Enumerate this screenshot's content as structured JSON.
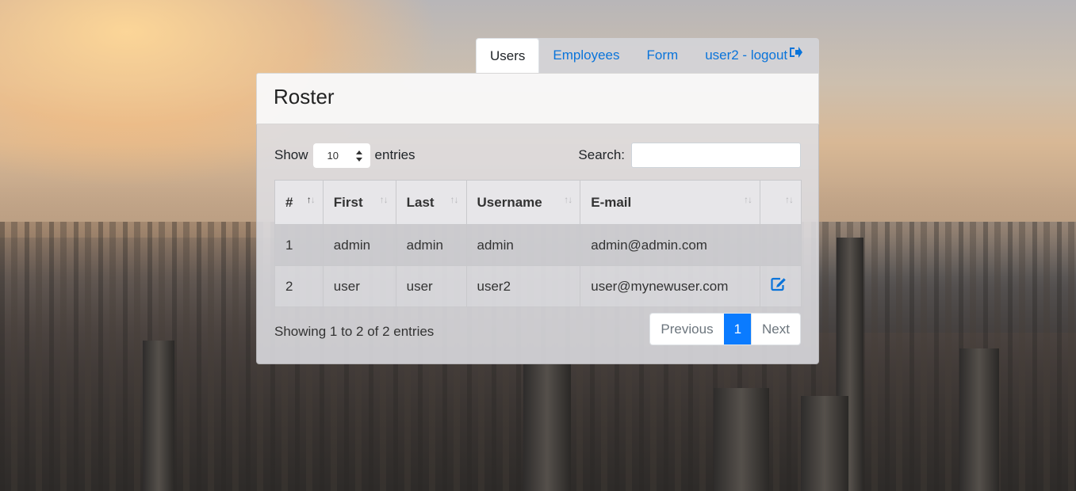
{
  "nav": {
    "tabs": [
      {
        "label": "Users",
        "active": true
      },
      {
        "label": "Employees",
        "active": false
      },
      {
        "label": "Form",
        "active": false
      },
      {
        "label": "user2 - logout",
        "active": false,
        "icon": "logout-icon"
      }
    ]
  },
  "card": {
    "title": "Roster"
  },
  "controls": {
    "show_label": "Show",
    "page_length": "10",
    "entries_label": "entries",
    "search_label": "Search:",
    "search_value": ""
  },
  "table": {
    "columns": [
      "#",
      "First",
      "Last",
      "Username",
      "E-mail",
      ""
    ],
    "sorted_column": 0,
    "rows": [
      {
        "id": "1",
        "first": "admin",
        "last": "admin",
        "username": "admin",
        "email": "admin@admin.com",
        "editable": false
      },
      {
        "id": "2",
        "first": "user",
        "last": "user",
        "username": "user2",
        "email": "user@mynewuser.com",
        "editable": true
      }
    ]
  },
  "footer": {
    "info": "Showing 1 to 2 of 2 entries",
    "previous": "Previous",
    "current_page": "1",
    "next": "Next"
  },
  "colors": {
    "link": "#0a74da",
    "active_page": "#0a7bff"
  }
}
